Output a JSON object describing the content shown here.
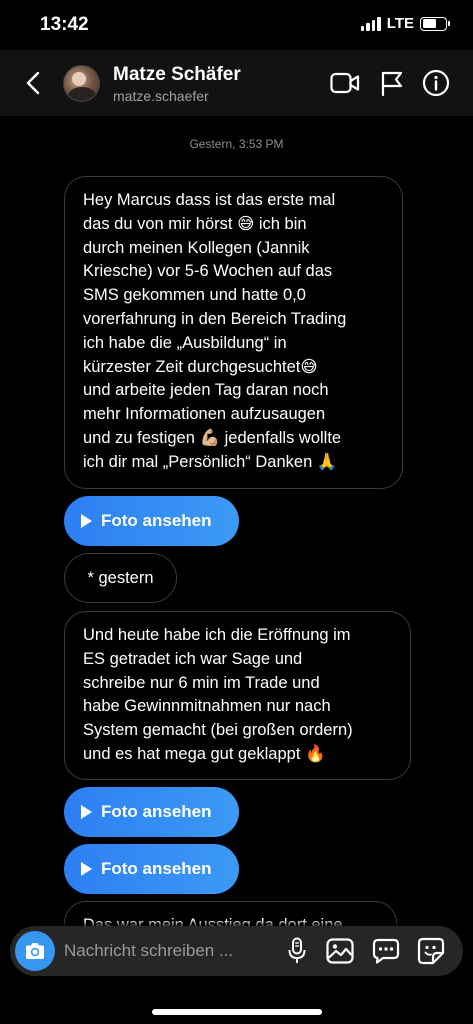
{
  "status_bar": {
    "time": "13:42",
    "network": "LTE"
  },
  "header": {
    "name": "Matze Schäfer",
    "username": "matze.schaefer"
  },
  "timestamp": "Gestern, 3:53 PM",
  "messages": [
    {
      "type": "text",
      "lines": [
        "Hey Marcus dass ist das erste mal",
        "das du von mir hörst 😅 ich bin",
        "durch meinen Kollegen (Jannik",
        "Kriesche) vor 5-6 Wochen auf das",
        "SMS gekommen und hatte 0,0",
        "vorerfahrung in den Bereich Trading",
        "ich habe die „Ausbildung“ in",
        "kürzester Zeit durchgesuchtet😅",
        "und arbeite jeden Tag daran noch",
        "mehr Informationen aufzusaugen",
        "und zu festigen 💪🏼 jedenfalls wollte",
        "ich dir mal „Persönlich“ Danken 🙏"
      ]
    },
    {
      "type": "photo",
      "label": "Foto ansehen"
    },
    {
      "type": "text_small",
      "text": "* gestern"
    },
    {
      "type": "text",
      "lines": [
        "Und heute habe ich die Eröffnung im",
        "ES getradet ich war Sage und",
        "schreibe nur 6 min im Trade und",
        "habe Gewinnmitnahmen nur nach",
        "System gemacht (bei großen ordern)",
        "und es hat mega gut geklappt 🔥"
      ]
    },
    {
      "type": "photo",
      "label": "Foto ansehen"
    },
    {
      "type": "photo",
      "label": "Foto ansehen"
    },
    {
      "type": "text",
      "lines": [
        "Das war mein Ausstieg da dort eine"
      ]
    }
  ],
  "composer": {
    "placeholder": "Nachricht schreiben ..."
  },
  "colors": {
    "accent": "#3797f0",
    "bubble_border": "#3a3a3a",
    "header_bg": "#121212",
    "composer_bg": "#262626"
  },
  "icons": [
    "back-arrow-icon",
    "video-call-icon",
    "flag-icon",
    "info-icon",
    "camera-icon",
    "microphone-icon",
    "gallery-icon",
    "chat-bubble-icon",
    "sticker-icon"
  ]
}
